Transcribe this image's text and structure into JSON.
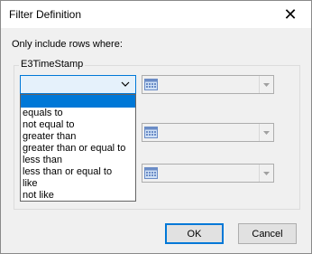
{
  "dialog": {
    "title": "Filter Definition",
    "close_glyph": "✕",
    "intro": "Only include rows where:",
    "group_label": "E3TimeStamp"
  },
  "operator_combo": {
    "selected": "",
    "options": [
      "equals to",
      "not equal to",
      "greater than",
      "greater than or equal to",
      "less than",
      "less than or equal to",
      "like",
      "not like"
    ]
  },
  "icons": {
    "calendar": "calendar-icon",
    "dropdown": "chevron-down-icon",
    "close": "close-icon"
  },
  "buttons": {
    "ok": "OK",
    "cancel": "Cancel"
  },
  "colors": {
    "accent": "#0078d7",
    "dialog_bg": "#f0f0f0"
  }
}
